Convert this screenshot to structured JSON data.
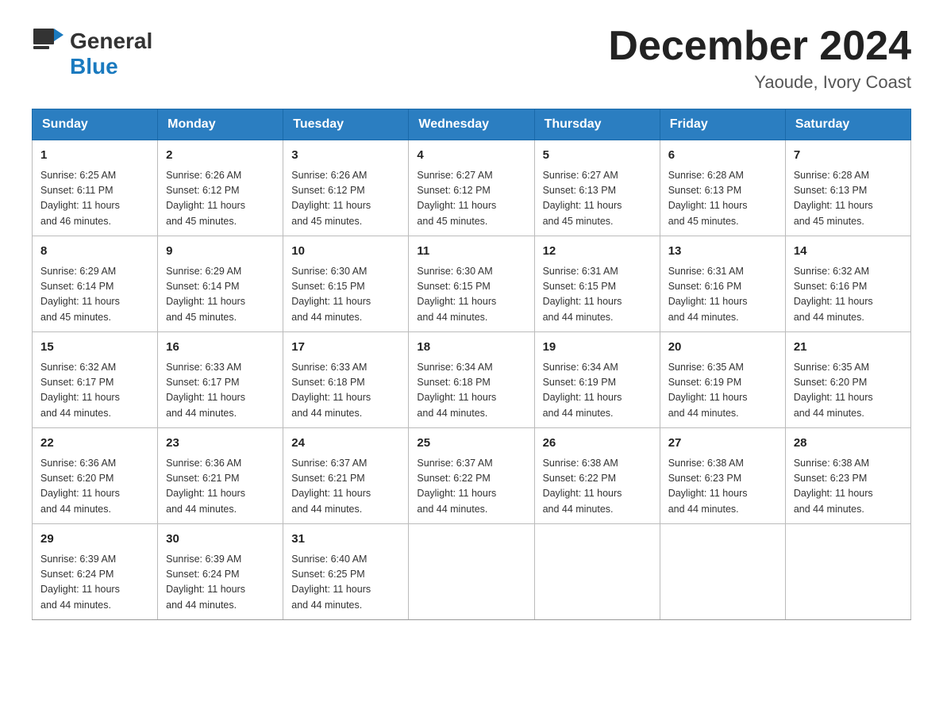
{
  "header": {
    "logo_general": "General",
    "logo_blue": "Blue",
    "month_title": "December 2024",
    "location": "Yaoude, Ivory Coast"
  },
  "days_of_week": [
    "Sunday",
    "Monday",
    "Tuesday",
    "Wednesday",
    "Thursday",
    "Friday",
    "Saturday"
  ],
  "weeks": [
    [
      {
        "day": "1",
        "sunrise": "6:25 AM",
        "sunset": "6:11 PM",
        "daylight": "11 hours and 46 minutes."
      },
      {
        "day": "2",
        "sunrise": "6:26 AM",
        "sunset": "6:12 PM",
        "daylight": "11 hours and 45 minutes."
      },
      {
        "day": "3",
        "sunrise": "6:26 AM",
        "sunset": "6:12 PM",
        "daylight": "11 hours and 45 minutes."
      },
      {
        "day": "4",
        "sunrise": "6:27 AM",
        "sunset": "6:12 PM",
        "daylight": "11 hours and 45 minutes."
      },
      {
        "day": "5",
        "sunrise": "6:27 AM",
        "sunset": "6:13 PM",
        "daylight": "11 hours and 45 minutes."
      },
      {
        "day": "6",
        "sunrise": "6:28 AM",
        "sunset": "6:13 PM",
        "daylight": "11 hours and 45 minutes."
      },
      {
        "day": "7",
        "sunrise": "6:28 AM",
        "sunset": "6:13 PM",
        "daylight": "11 hours and 45 minutes."
      }
    ],
    [
      {
        "day": "8",
        "sunrise": "6:29 AM",
        "sunset": "6:14 PM",
        "daylight": "11 hours and 45 minutes."
      },
      {
        "day": "9",
        "sunrise": "6:29 AM",
        "sunset": "6:14 PM",
        "daylight": "11 hours and 45 minutes."
      },
      {
        "day": "10",
        "sunrise": "6:30 AM",
        "sunset": "6:15 PM",
        "daylight": "11 hours and 44 minutes."
      },
      {
        "day": "11",
        "sunrise": "6:30 AM",
        "sunset": "6:15 PM",
        "daylight": "11 hours and 44 minutes."
      },
      {
        "day": "12",
        "sunrise": "6:31 AM",
        "sunset": "6:15 PM",
        "daylight": "11 hours and 44 minutes."
      },
      {
        "day": "13",
        "sunrise": "6:31 AM",
        "sunset": "6:16 PM",
        "daylight": "11 hours and 44 minutes."
      },
      {
        "day": "14",
        "sunrise": "6:32 AM",
        "sunset": "6:16 PM",
        "daylight": "11 hours and 44 minutes."
      }
    ],
    [
      {
        "day": "15",
        "sunrise": "6:32 AM",
        "sunset": "6:17 PM",
        "daylight": "11 hours and 44 minutes."
      },
      {
        "day": "16",
        "sunrise": "6:33 AM",
        "sunset": "6:17 PM",
        "daylight": "11 hours and 44 minutes."
      },
      {
        "day": "17",
        "sunrise": "6:33 AM",
        "sunset": "6:18 PM",
        "daylight": "11 hours and 44 minutes."
      },
      {
        "day": "18",
        "sunrise": "6:34 AM",
        "sunset": "6:18 PM",
        "daylight": "11 hours and 44 minutes."
      },
      {
        "day": "19",
        "sunrise": "6:34 AM",
        "sunset": "6:19 PM",
        "daylight": "11 hours and 44 minutes."
      },
      {
        "day": "20",
        "sunrise": "6:35 AM",
        "sunset": "6:19 PM",
        "daylight": "11 hours and 44 minutes."
      },
      {
        "day": "21",
        "sunrise": "6:35 AM",
        "sunset": "6:20 PM",
        "daylight": "11 hours and 44 minutes."
      }
    ],
    [
      {
        "day": "22",
        "sunrise": "6:36 AM",
        "sunset": "6:20 PM",
        "daylight": "11 hours and 44 minutes."
      },
      {
        "day": "23",
        "sunrise": "6:36 AM",
        "sunset": "6:21 PM",
        "daylight": "11 hours and 44 minutes."
      },
      {
        "day": "24",
        "sunrise": "6:37 AM",
        "sunset": "6:21 PM",
        "daylight": "11 hours and 44 minutes."
      },
      {
        "day": "25",
        "sunrise": "6:37 AM",
        "sunset": "6:22 PM",
        "daylight": "11 hours and 44 minutes."
      },
      {
        "day": "26",
        "sunrise": "6:38 AM",
        "sunset": "6:22 PM",
        "daylight": "11 hours and 44 minutes."
      },
      {
        "day": "27",
        "sunrise": "6:38 AM",
        "sunset": "6:23 PM",
        "daylight": "11 hours and 44 minutes."
      },
      {
        "day": "28",
        "sunrise": "6:38 AM",
        "sunset": "6:23 PM",
        "daylight": "11 hours and 44 minutes."
      }
    ],
    [
      {
        "day": "29",
        "sunrise": "6:39 AM",
        "sunset": "6:24 PM",
        "daylight": "11 hours and 44 minutes."
      },
      {
        "day": "30",
        "sunrise": "6:39 AM",
        "sunset": "6:24 PM",
        "daylight": "11 hours and 44 minutes."
      },
      {
        "day": "31",
        "sunrise": "6:40 AM",
        "sunset": "6:25 PM",
        "daylight": "11 hours and 44 minutes."
      },
      {
        "day": "",
        "sunrise": "",
        "sunset": "",
        "daylight": ""
      },
      {
        "day": "",
        "sunrise": "",
        "sunset": "",
        "daylight": ""
      },
      {
        "day": "",
        "sunrise": "",
        "sunset": "",
        "daylight": ""
      },
      {
        "day": "",
        "sunrise": "",
        "sunset": "",
        "daylight": ""
      }
    ]
  ],
  "labels": {
    "sunrise_prefix": "Sunrise: ",
    "sunset_prefix": "Sunset: ",
    "daylight_prefix": "Daylight: "
  }
}
